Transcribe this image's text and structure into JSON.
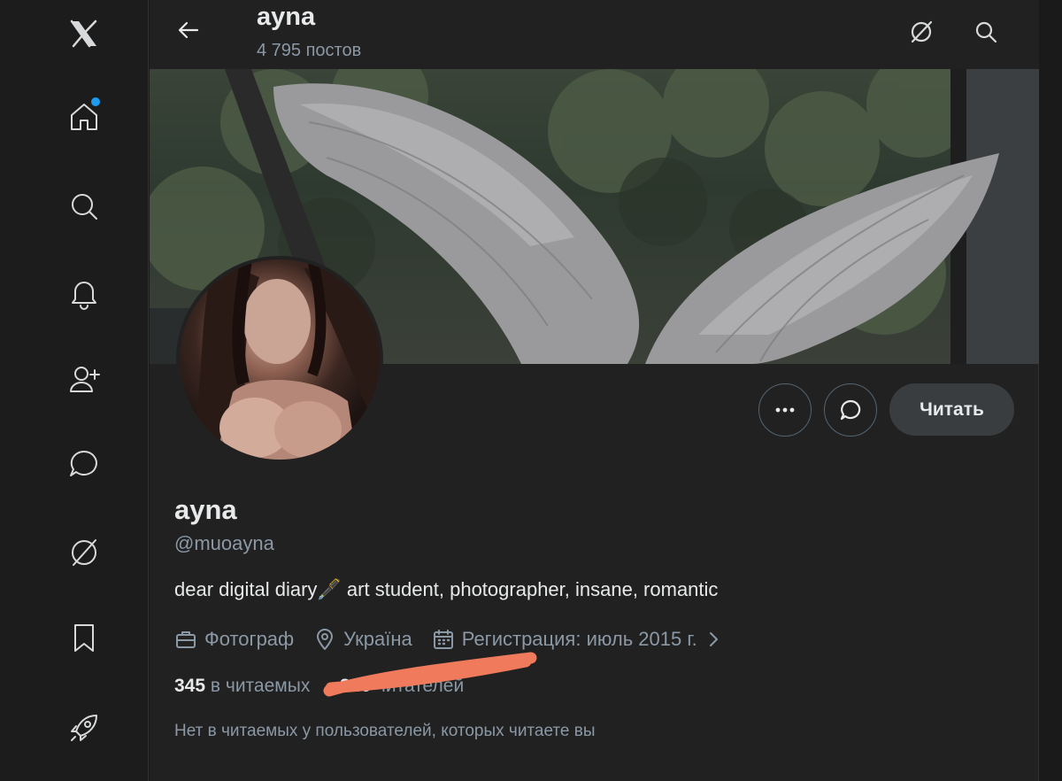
{
  "header": {
    "title": "ayna",
    "post_count": "4 795 постов"
  },
  "profile": {
    "display_name": "ayna",
    "handle": "@muoayna",
    "bio": "dear digital diary🖋️ art student, photographer, insane, romantic",
    "profession": "Фотограф",
    "location": "Україна",
    "joined": "Регистрация: июль 2015 г.",
    "following_count": "345",
    "following_label": "в читаемых",
    "followers_count": "346",
    "followers_label": "читателей",
    "mutuals_note": "Нет в читаемых у пользователей, которых читаете вы"
  },
  "actions": {
    "follow_label": "Читать"
  },
  "nav": {
    "items": [
      "x-logo",
      "home",
      "search",
      "notifications",
      "follow",
      "messages",
      "grok",
      "bookmarks",
      "premium"
    ]
  },
  "colors": {
    "accent": "#1d9bf0",
    "background": "#212121",
    "scribble": "#f07a5c"
  }
}
